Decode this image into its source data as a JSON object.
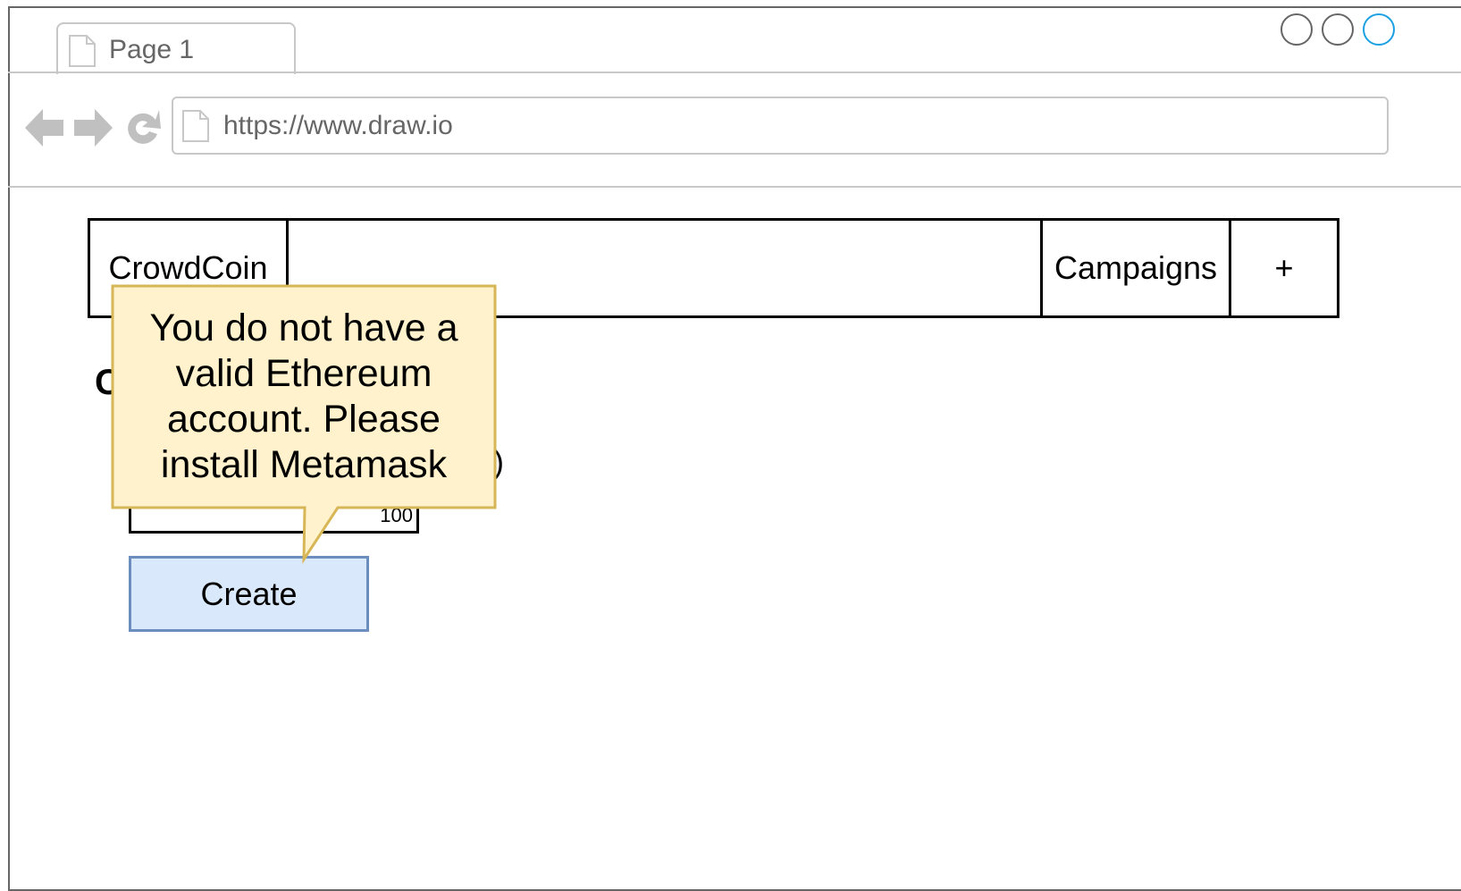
{
  "browser": {
    "tab_label": "Page 1",
    "url": "https://www.draw.io"
  },
  "app": {
    "brand": "CrowdCoin",
    "nav_campaigns": "Campaigns",
    "nav_add": "+",
    "heading_visible": "C",
    "field_label_visible": "ei)",
    "min_contribution_value": "100",
    "create_label": "Create"
  },
  "tooltip": {
    "message": "You do not have a valid Ethereum account.  Please install Metamask"
  },
  "icons": {
    "back": "back-arrow-icon",
    "forward": "forward-arrow-icon",
    "reload": "reload-icon",
    "page": "page-icon"
  },
  "colors": {
    "button_fill": "#dae8fc",
    "button_border": "#6c8ebf",
    "tooltip_fill": "#fff2cc",
    "tooltip_border": "#d6b656",
    "window_control_active": "#1ba1e2"
  }
}
